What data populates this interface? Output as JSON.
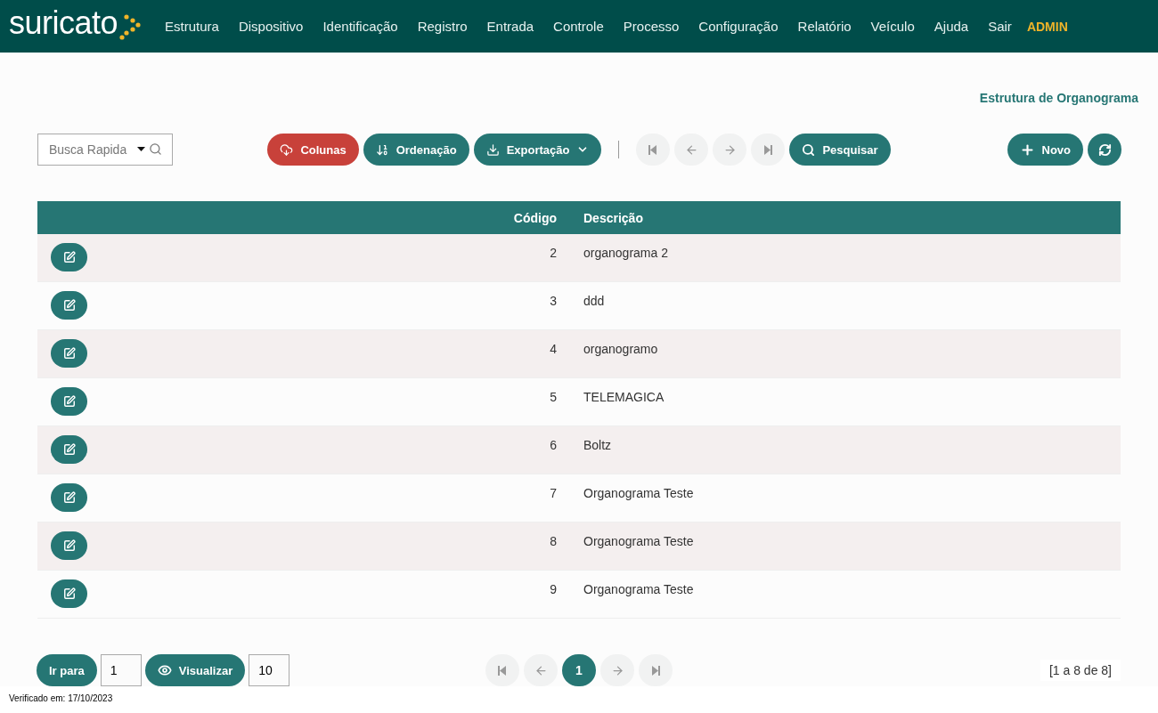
{
  "nav": {
    "logo": "suricato",
    "items": [
      "Estrutura",
      "Dispositivo",
      "Identificação",
      "Registro",
      "Entrada",
      "Controle",
      "Processo",
      "Configuração",
      "Relatório",
      "Veículo",
      "Ajuda",
      "Sair"
    ],
    "user": "ADMIN"
  },
  "page_title": "Estrutura de Organograma",
  "search": {
    "placeholder": "Busca Rapida"
  },
  "toolbar": {
    "actions": [
      {
        "kind": "columns",
        "label": "Colunas"
      },
      {
        "kind": "sort",
        "label": "Ordenação"
      },
      {
        "kind": "export",
        "label": "Exportação"
      }
    ],
    "pager": [
      {
        "kind": "first",
        "disabled": true
      },
      {
        "kind": "prev",
        "disabled": true
      },
      {
        "kind": "next",
        "disabled": true
      },
      {
        "kind": "last",
        "disabled": true
      }
    ],
    "search_button": "Pesquisar",
    "new_button": "Novo"
  },
  "table": {
    "columns": [
      "Código",
      "Descrição"
    ],
    "rows": [
      {
        "code": "2",
        "description": "organograma 2"
      },
      {
        "code": "3",
        "description": "ddd"
      },
      {
        "code": "4",
        "description": "organogramo"
      },
      {
        "code": "5",
        "description": "TELEMAGICA"
      },
      {
        "code": "6",
        "description": "Boltz"
      },
      {
        "code": "7",
        "description": "Organograma Teste"
      },
      {
        "code": "8",
        "description": "Organograma Teste"
      },
      {
        "code": "9",
        "description": "Organograma Teste"
      }
    ]
  },
  "footer": {
    "goto_label": "Ir para",
    "goto_value": "1",
    "view_label": "Visualizar",
    "view_value": "10",
    "pager": [
      {
        "kind": "first",
        "disabled": true
      },
      {
        "kind": "prev",
        "disabled": true
      },
      {
        "kind": "page",
        "label": "1",
        "selected": true
      },
      {
        "kind": "next",
        "disabled": true
      },
      {
        "kind": "last",
        "disabled": true
      }
    ],
    "range": "[1 a 8 de 8]"
  },
  "verified": "Verificado em: 17/10/2023"
}
